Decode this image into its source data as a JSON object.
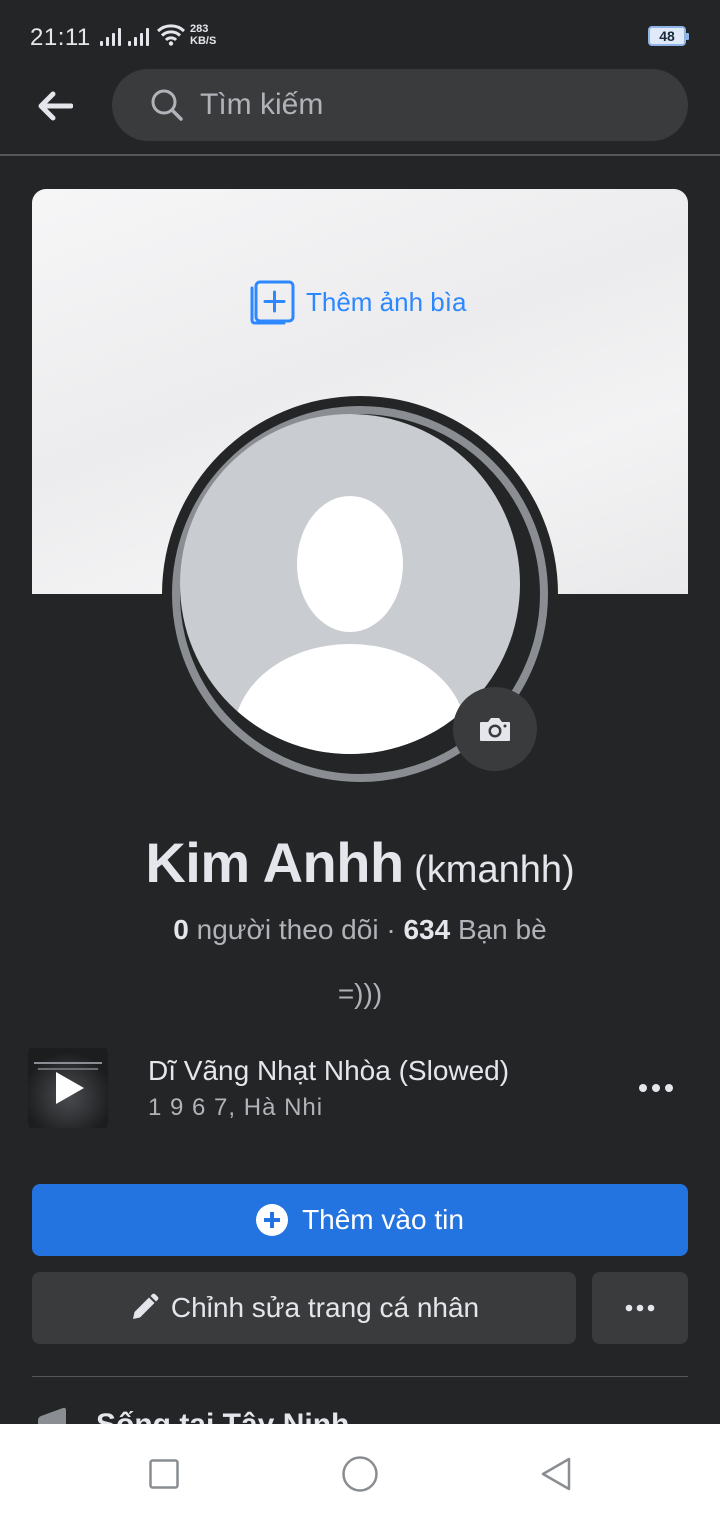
{
  "status_bar": {
    "time": "21:11",
    "net_speed_value": "283",
    "net_speed_unit": "KB/S",
    "battery": "48"
  },
  "header": {
    "search_placeholder": "Tìm kiếm"
  },
  "cover": {
    "add_cover_label": "Thêm ảnh bìa"
  },
  "profile": {
    "name": "Kim Anhh",
    "username": "(kmanhh)",
    "followers_count": "0",
    "followers_label": "người theo dõi",
    "separator": "·",
    "friends_count": "634",
    "friends_label": "Bạn bè",
    "bio": "=)))"
  },
  "music": {
    "title": "Dĩ Vãng Nhạt Nhòa (Slowed)",
    "artist": "1 9 6 7, Hà Nhi"
  },
  "actions": {
    "add_story_label": "Thêm vào tin",
    "edit_profile_label": "Chỉnh sửa trang cá nhân"
  },
  "partial": {
    "text": "Sống tại Tây Ninh"
  },
  "colors": {
    "background": "#242527",
    "accent": "#2374e1",
    "link": "#2d88ff",
    "secondary_button": "#3a3b3c"
  }
}
